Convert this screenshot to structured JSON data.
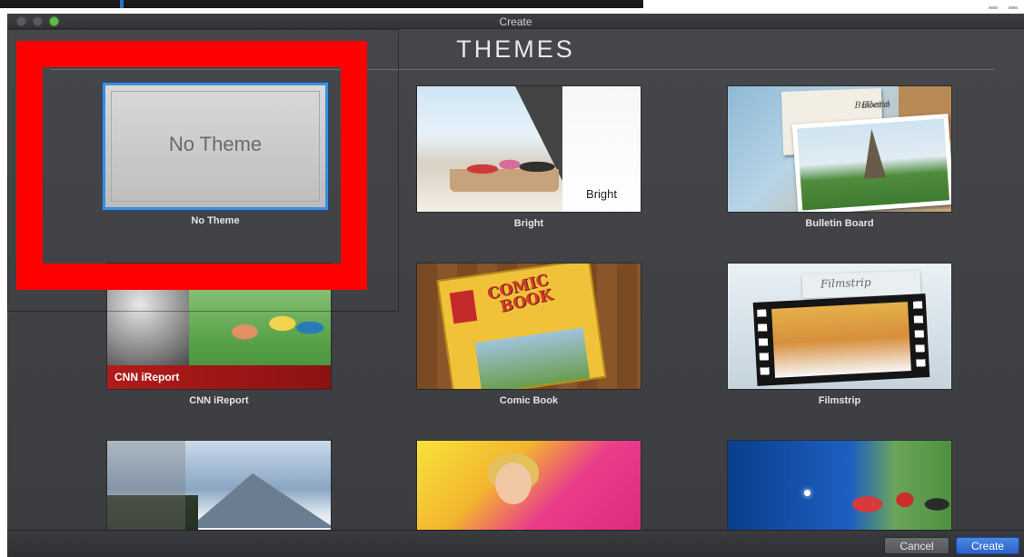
{
  "window": {
    "title": "Create"
  },
  "heading": "THEMES",
  "themes": [
    {
      "label": "No Theme",
      "thumb_text": "No Theme"
    },
    {
      "label": "Bright",
      "thumb_text": "Bright"
    },
    {
      "label": "Bulletin Board",
      "thumb_text_line1": "Bulletin",
      "thumb_text_line2": "Board"
    },
    {
      "label": "CNN iReport",
      "thumb_text": "CNN iReport"
    },
    {
      "label": "Comic Book",
      "thumb_text_line1": "COMIC",
      "thumb_text_line2": "BOOK"
    },
    {
      "label": "Filmstrip",
      "thumb_text": "Filmstrip"
    }
  ],
  "buttons": {
    "cancel": "Cancel",
    "create": "Create"
  },
  "colors": {
    "highlight": "#ff0000",
    "accent": "#2c63c8",
    "selection": "#3d8ee0"
  }
}
